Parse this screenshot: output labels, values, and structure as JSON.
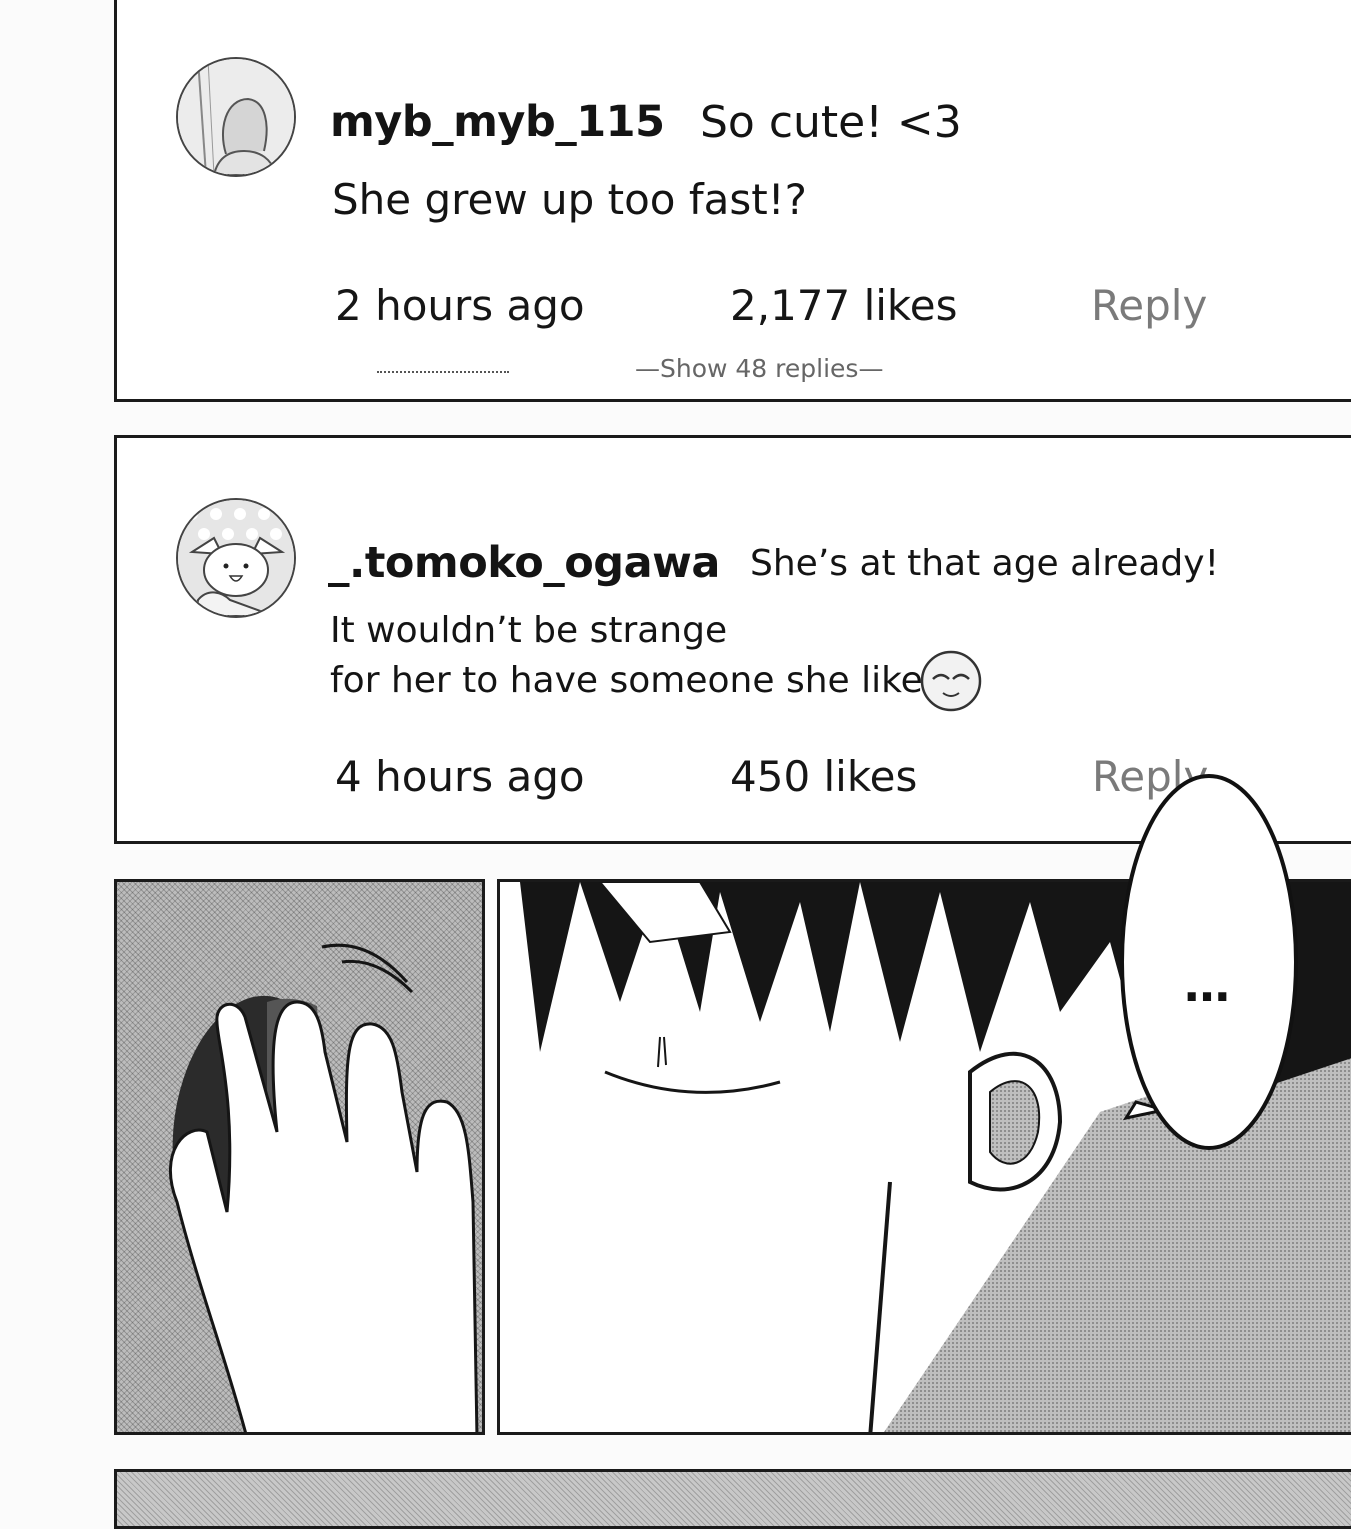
{
  "comments": [
    {
      "username": "myb_myb_115",
      "text_line1": "So cute! <3",
      "text_line2": "She grew up too fast!?",
      "time": "2 hours ago",
      "likes": "2,177 likes",
      "reply_label": "Reply",
      "show_replies": "—Show 48 replies—"
    },
    {
      "username": "_.tomoko_ogawa",
      "text_line1": "She’s at that age already!",
      "text_line2": "It wouldn’t be strange",
      "text_line3": "for her to have someone she likes",
      "time": "4 hours ago",
      "likes": "450 likes",
      "reply_label": "Reply"
    }
  ],
  "speech_bubble": {
    "text": "…"
  },
  "icons": [
    "avatar-person-icon",
    "avatar-dog-icon",
    "smile-emoji-icon"
  ]
}
